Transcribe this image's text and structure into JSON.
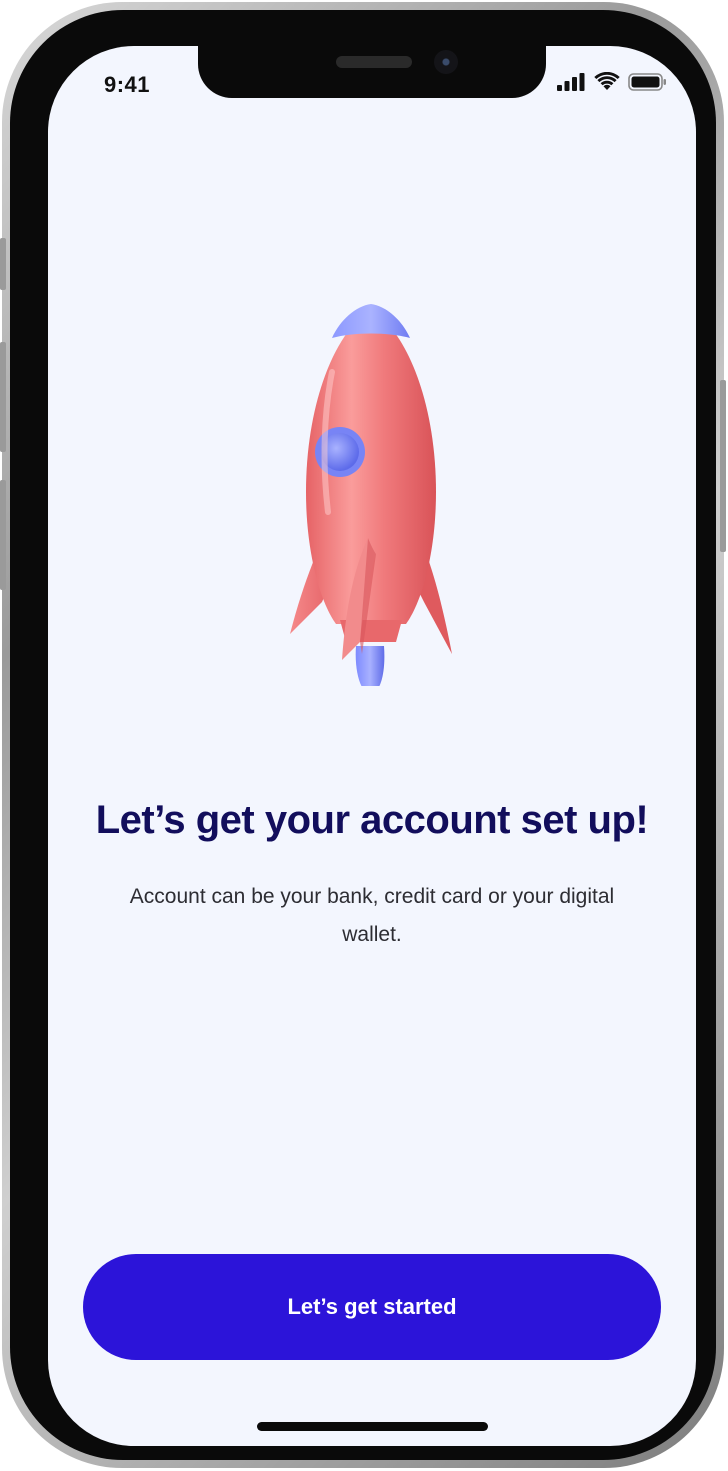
{
  "status_bar": {
    "time": "9:41",
    "signal_icon": "cellular-signal-icon",
    "wifi_icon": "wifi-icon",
    "battery_icon": "battery-icon"
  },
  "illustration": {
    "icon": "rocket-illustration",
    "colors": {
      "body": "#f07a7c",
      "accent": "#6f7cf2"
    }
  },
  "onboarding": {
    "title": "Let’s get your account set up!",
    "description": "Account can be your bank, credit card or your digital wallet.",
    "cta_label": "Let’s get started"
  },
  "colors": {
    "background": "#f3f6fe",
    "title": "#120e5c",
    "primary_button": "#2c14d9"
  }
}
